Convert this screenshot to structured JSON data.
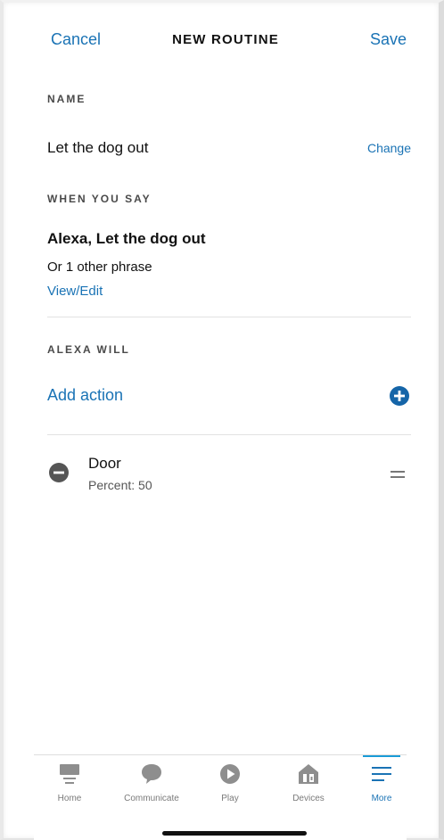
{
  "header": {
    "cancel_label": "Cancel",
    "title": "NEW ROUTINE",
    "save_label": "Save"
  },
  "name_section": {
    "label": "NAME",
    "value": "Let the dog out",
    "change_label": "Change"
  },
  "when_section": {
    "label": "WHEN YOU SAY",
    "phrase": "Alexa, Let the dog out",
    "other_phrases": "Or 1 other phrase",
    "view_edit_label": "View/Edit"
  },
  "actions_section": {
    "label": "ALEXA WILL",
    "add_action_label": "Add action",
    "items": [
      {
        "title": "Door",
        "subtitle": "Percent: 50"
      }
    ]
  },
  "tabbar": {
    "tabs": [
      {
        "label": "Home",
        "icon": "home-icon"
      },
      {
        "label": "Communicate",
        "icon": "chat-bubble-icon"
      },
      {
        "label": "Play",
        "icon": "play-icon"
      },
      {
        "label": "Devices",
        "icon": "devices-house-icon"
      },
      {
        "label": "More",
        "icon": "menu-icon"
      }
    ],
    "active": "More"
  },
  "colors": {
    "accent": "#1a73b5",
    "add_icon": "#1565a8",
    "remove_icon": "#555555",
    "tab_inactive": "#9a9a9a"
  }
}
